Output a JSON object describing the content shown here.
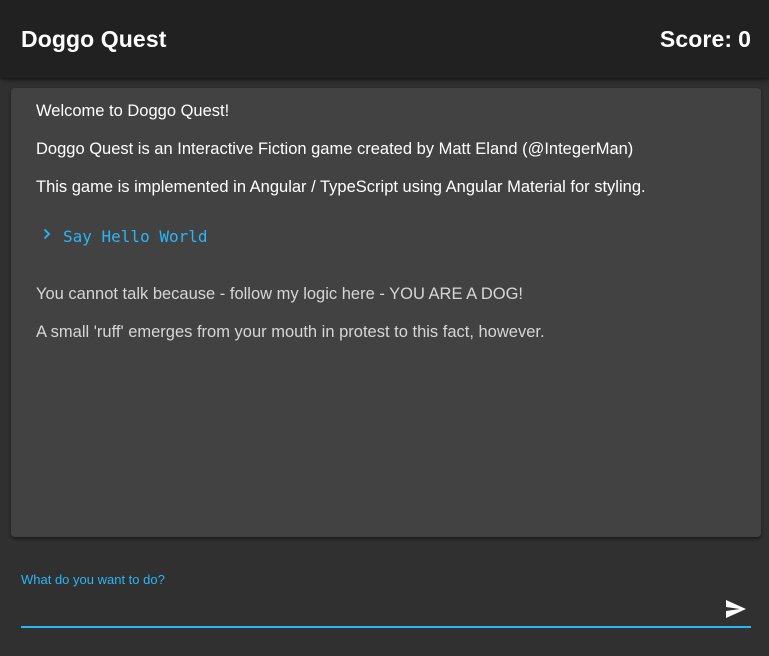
{
  "header": {
    "title": "Doggo Quest",
    "score_label": "Score:",
    "score_value": "0"
  },
  "story": {
    "intro": [
      "Welcome to Doggo Quest!",
      "Doggo Quest is an Interactive Fiction game created by Matt Eland (@IntegerMan)",
      "This game is implemented in Angular / TypeScript using Angular Material for styling."
    ],
    "command": "Say Hello World",
    "responses": [
      "You cannot talk because - follow my logic here - YOU ARE A DOG!",
      "A small 'ruff' emerges from your mouth in protest to this fact, however."
    ]
  },
  "input": {
    "label": "What do you want to do?",
    "value": ""
  },
  "icons": {
    "command_prompt": "chevron-right-icon",
    "send": "send-icon"
  },
  "colors": {
    "accent": "#29b6f6",
    "toolbar": "#212121",
    "background": "#303030",
    "card": "#424242"
  }
}
